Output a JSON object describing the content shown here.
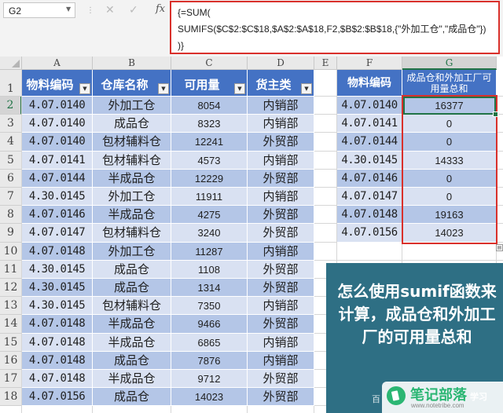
{
  "formula_bar": {
    "name_box": "G2",
    "formula_lines": [
      "{=SUM(",
      "SUMIFS($C$2:$C$18,$A$2:$A$18,F2,$B$2:$B$18,{\"外加工仓\",\"成品仓\"})",
      ")}"
    ],
    "cancel_icon": "close-icon",
    "enter_icon": "check-icon",
    "fx_label": "fx"
  },
  "columns": [
    "A",
    "B",
    "C",
    "D",
    "E",
    "F",
    "G"
  ],
  "rows": [
    "1",
    "2",
    "3",
    "4",
    "5",
    "6",
    "7",
    "8",
    "9",
    "10",
    "11",
    "12",
    "13",
    "14",
    "15",
    "16",
    "17",
    "18"
  ],
  "table": {
    "headers": [
      "物料编码",
      "仓库名称",
      "可用量",
      "货主类"
    ],
    "rows": [
      [
        "4.07.0140",
        "外加工仓",
        "8054",
        "内销部"
      ],
      [
        "4.07.0140",
        "成品仓",
        "8323",
        "内销部"
      ],
      [
        "4.07.0140",
        "包材辅料仓",
        "12241",
        "外贸部"
      ],
      [
        "4.07.0141",
        "包材辅料仓",
        "4573",
        "内销部"
      ],
      [
        "4.07.0144",
        "半成品仓",
        "12229",
        "外贸部"
      ],
      [
        "4.30.0145",
        "外加工仓",
        "11911",
        "内销部"
      ],
      [
        "4.07.0146",
        "半成品仓",
        "4275",
        "外贸部"
      ],
      [
        "4.07.0147",
        "包材辅料仓",
        "3240",
        "外贸部"
      ],
      [
        "4.07.0148",
        "外加工仓",
        "11287",
        "内销部"
      ],
      [
        "4.30.0145",
        "成品仓",
        "1108",
        "外贸部"
      ],
      [
        "4.30.0145",
        "成品仓",
        "1314",
        "外贸部"
      ],
      [
        "4.30.0145",
        "包材辅料仓",
        "7350",
        "内销部"
      ],
      [
        "4.07.0148",
        "半成品仓",
        "9466",
        "外贸部"
      ],
      [
        "4.07.0148",
        "半成品仓",
        "6865",
        "内销部"
      ],
      [
        "4.07.0148",
        "成品仓",
        "7876",
        "内销部"
      ],
      [
        "4.07.0148",
        "半成品仓",
        "9712",
        "外贸部"
      ],
      [
        "4.07.0156",
        "成品仓",
        "14023",
        "外贸部"
      ]
    ]
  },
  "result": {
    "headers": [
      "物料编码",
      "成品仓和外加工厂可用量总和"
    ],
    "rows": [
      [
        "4.07.0140",
        "16377"
      ],
      [
        "4.07.0141",
        "0"
      ],
      [
        "4.07.0144",
        "0"
      ],
      [
        "4.30.0145",
        "14333"
      ],
      [
        "4.07.0146",
        "0"
      ],
      [
        "4.07.0147",
        "0"
      ],
      [
        "4.07.0148",
        "19163"
      ],
      [
        "4.07.0156",
        "14023"
      ]
    ]
  },
  "callout": {
    "text": "怎么使用sumif函数来计算，成品仓和外加工厂的可用量总和",
    "footer": "百"
  },
  "watermark": {
    "name": "笔记部落",
    "url": "www.notetribe.com",
    "suffix": "学习",
    "brand_color": "#2bb673"
  },
  "colors": {
    "header_blue": "#4472c4",
    "band_dark": "#b4c6e7",
    "band_light": "#d9e1f2",
    "highlight_red": "#d9302b",
    "selection_green": "#217346",
    "callout_bg": "#2e6f84"
  }
}
